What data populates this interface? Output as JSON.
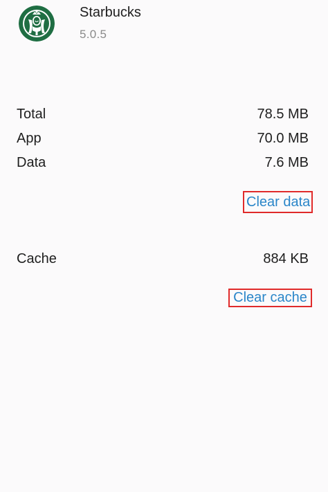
{
  "app": {
    "name": "Starbucks",
    "version": "5.0.5",
    "icon": "starbucks-siren-logo",
    "icon_color": "#1f6e43"
  },
  "storage": {
    "rows": [
      {
        "label": "Total",
        "value": "78.5 MB"
      },
      {
        "label": "App",
        "value": "70.0 MB"
      },
      {
        "label": "Data",
        "value": "7.6 MB"
      }
    ],
    "clear_data_label": "Clear data"
  },
  "cache": {
    "label": "Cache",
    "value": "884 KB",
    "clear_cache_label": "Clear cache"
  },
  "colors": {
    "background": "#fbfafb",
    "link": "#2a86c9",
    "highlight_border": "#e02a2a"
  }
}
